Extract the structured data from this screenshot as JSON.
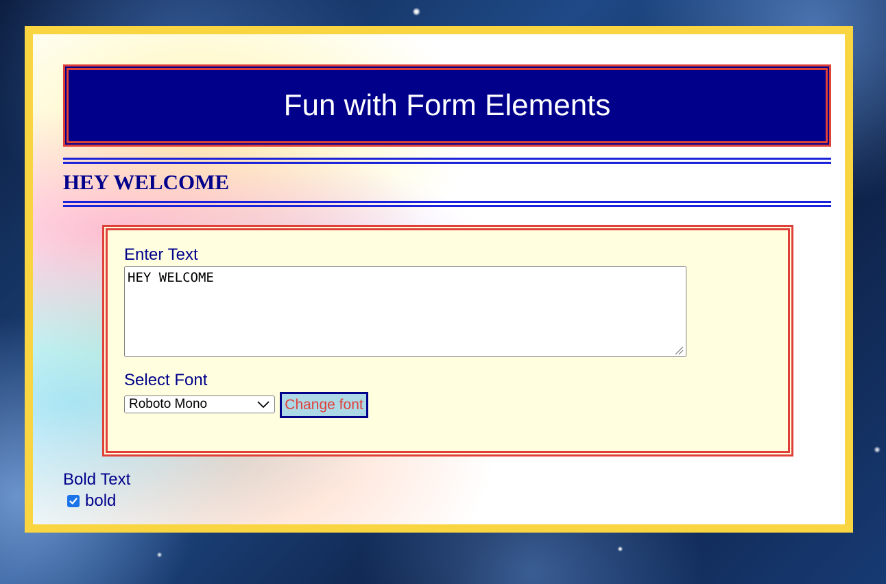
{
  "header": {
    "title": "Fun with Form Elements"
  },
  "section": {
    "heading": "HEY WELCOME"
  },
  "form": {
    "text_label": "Enter Text",
    "text_value": "HEY WELCOME",
    "font_label": "Select Font",
    "font_selected": "Roboto Mono",
    "change_button_label": "Change font"
  },
  "bold": {
    "label": "Bold Text",
    "checkbox_label": "bold",
    "checked": true
  },
  "colors": {
    "frame": "#fad542",
    "header_bg": "#00008b",
    "accent_red": "#e0403a",
    "rule_blue": "#1a23d8",
    "form_bg": "#ffffdf",
    "text_navy": "#00008b",
    "button_bg": "#add8e6",
    "checkbox": "#1a73e8"
  },
  "icons": {
    "select_arrow": "chevron-down-icon",
    "checkbox_mark": "checkmark-icon",
    "resize_grip": "resize-grip-icon"
  }
}
